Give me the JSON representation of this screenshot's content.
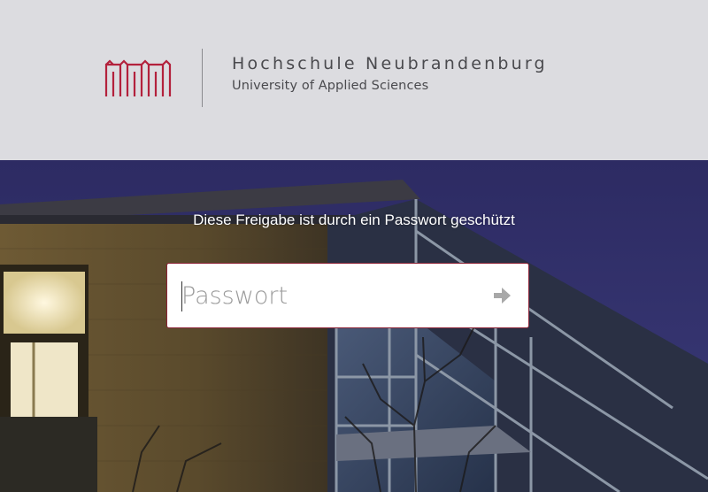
{
  "header": {
    "title": "Hochschule Neubrandenburg",
    "subtitle": "University of Applied Sciences"
  },
  "login": {
    "prompt": "Diese Freigabe ist durch ein Passwort geschützt",
    "password_placeholder": "Passwort",
    "password_value": ""
  },
  "icons": {
    "logo": "university-logo-icon",
    "submit": "arrow-right-icon"
  },
  "colors": {
    "header_bg": "#dcdce0",
    "logo_red": "#b3213c",
    "input_border": "#8c2336",
    "sky": "#2f2d63"
  }
}
